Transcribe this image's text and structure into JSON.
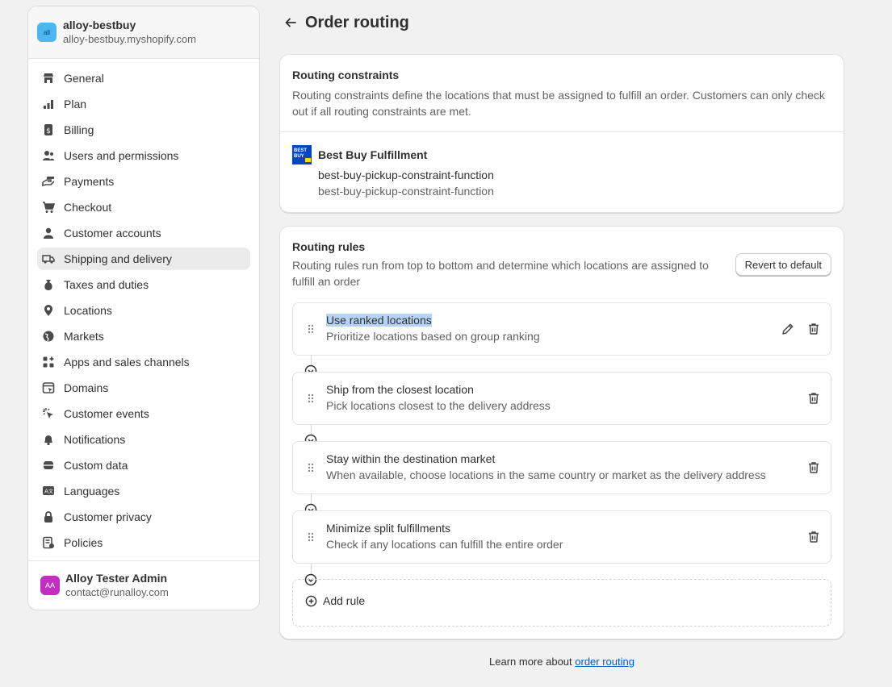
{
  "store": {
    "name": "alloy-bestbuy",
    "domain": "alloy-bestbuy.myshopify.com",
    "logo_text": "all"
  },
  "sidebar": {
    "items": [
      {
        "label": "General",
        "icon": "store-icon"
      },
      {
        "label": "Plan",
        "icon": "plan-icon"
      },
      {
        "label": "Billing",
        "icon": "billing-icon"
      },
      {
        "label": "Users and permissions",
        "icon": "users-icon"
      },
      {
        "label": "Payments",
        "icon": "payments-icon"
      },
      {
        "label": "Checkout",
        "icon": "cart-icon"
      },
      {
        "label": "Customer accounts",
        "icon": "person-icon"
      },
      {
        "label": "Shipping and delivery",
        "icon": "truck-icon",
        "active": true
      },
      {
        "label": "Taxes and duties",
        "icon": "taxes-icon"
      },
      {
        "label": "Locations",
        "icon": "location-icon"
      },
      {
        "label": "Markets",
        "icon": "globe-icon"
      },
      {
        "label": "Apps and sales channels",
        "icon": "apps-icon"
      },
      {
        "label": "Domains",
        "icon": "domains-icon"
      },
      {
        "label": "Customer events",
        "icon": "cursor-icon"
      },
      {
        "label": "Notifications",
        "icon": "bell-icon"
      },
      {
        "label": "Custom data",
        "icon": "database-icon"
      },
      {
        "label": "Languages",
        "icon": "language-icon"
      },
      {
        "label": "Customer privacy",
        "icon": "lock-icon"
      },
      {
        "label": "Policies",
        "icon": "policies-icon"
      }
    ]
  },
  "user": {
    "initials": "AA",
    "name": "Alloy Tester Admin",
    "email": "contact@runalloy.com"
  },
  "page": {
    "title": "Order routing"
  },
  "constraints": {
    "title": "Routing constraints",
    "description": "Routing constraints define the locations that must be assigned to fulfill an order. Customers can only check out if all routing constraints are met.",
    "provider": {
      "logo_text": "BEST BUY",
      "name": "Best Buy Fulfillment",
      "function_title": "best-buy-pickup-constraint-function",
      "function_handle": "best-buy-pickup-constraint-function"
    }
  },
  "rules": {
    "title": "Routing rules",
    "description": "Routing rules run from top to bottom and determine which locations are assigned to fulfill an order",
    "revert_label": "Revert to default",
    "items": [
      {
        "title": "Use ranked locations",
        "description": "Prioritize locations based on group ranking"
      },
      {
        "title": "Ship from the closest location",
        "description": "Pick locations closest to the delivery address"
      },
      {
        "title": "Stay within the destination market",
        "description": "When available, choose locations in the same country or market as the delivery address"
      },
      {
        "title": "Minimize split fulfillments",
        "description": "Check if any locations can fulfill the entire order"
      }
    ],
    "add_label": "Add rule"
  },
  "footer": {
    "text": "Learn more about",
    "link": "order routing"
  }
}
